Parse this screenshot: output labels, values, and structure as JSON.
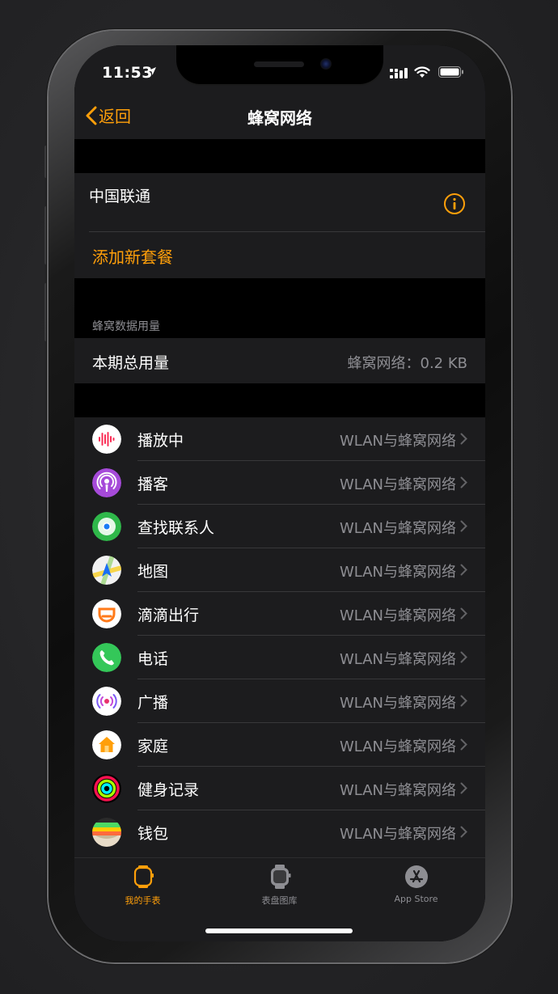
{
  "status_bar": {
    "time": "11:53"
  },
  "nav": {
    "back_label": "返回",
    "title": "蜂窝网络"
  },
  "carrier": {
    "name": "中国联通",
    "add_plan_label": "添加新套餐"
  },
  "usage": {
    "section_header": "蜂窝数据用量",
    "label": "本期总用量",
    "value": "蜂窝网络：0.2 KB"
  },
  "apps": [
    {
      "name": "播放中",
      "value": "WLAN与蜂窝网络",
      "icon": "now-playing-icon"
    },
    {
      "name": "播客",
      "value": "WLAN与蜂窝网络",
      "icon": "podcasts-icon"
    },
    {
      "name": "查找联系人",
      "value": "WLAN与蜂窝网络",
      "icon": "find-people-icon"
    },
    {
      "name": "地图",
      "value": "WLAN与蜂窝网络",
      "icon": "maps-icon"
    },
    {
      "name": "滴滴出行",
      "value": "WLAN与蜂窝网络",
      "icon": "didi-icon"
    },
    {
      "name": "电话",
      "value": "WLAN与蜂窝网络",
      "icon": "phone-icon"
    },
    {
      "name": "广播",
      "value": "WLAN与蜂窝网络",
      "icon": "radio-icon"
    },
    {
      "name": "家庭",
      "value": "WLAN与蜂窝网络",
      "icon": "home-icon"
    },
    {
      "name": "健身记录",
      "value": "WLAN与蜂窝网络",
      "icon": "activity-icon"
    },
    {
      "name": "钱包",
      "value": "WLAN与蜂窝网络",
      "icon": "wallet-icon"
    }
  ],
  "tabs": [
    {
      "label": "我的手表",
      "icon": "my-watch-icon",
      "active": true
    },
    {
      "label": "表盘图库",
      "icon": "face-gallery-icon",
      "active": false
    },
    {
      "label": "App Store",
      "icon": "app-store-icon",
      "active": false
    }
  ],
  "colors": {
    "accent": "#ff9f0a",
    "secondary_text": "#8e8e93",
    "cell_bg": "#1c1c1e"
  }
}
